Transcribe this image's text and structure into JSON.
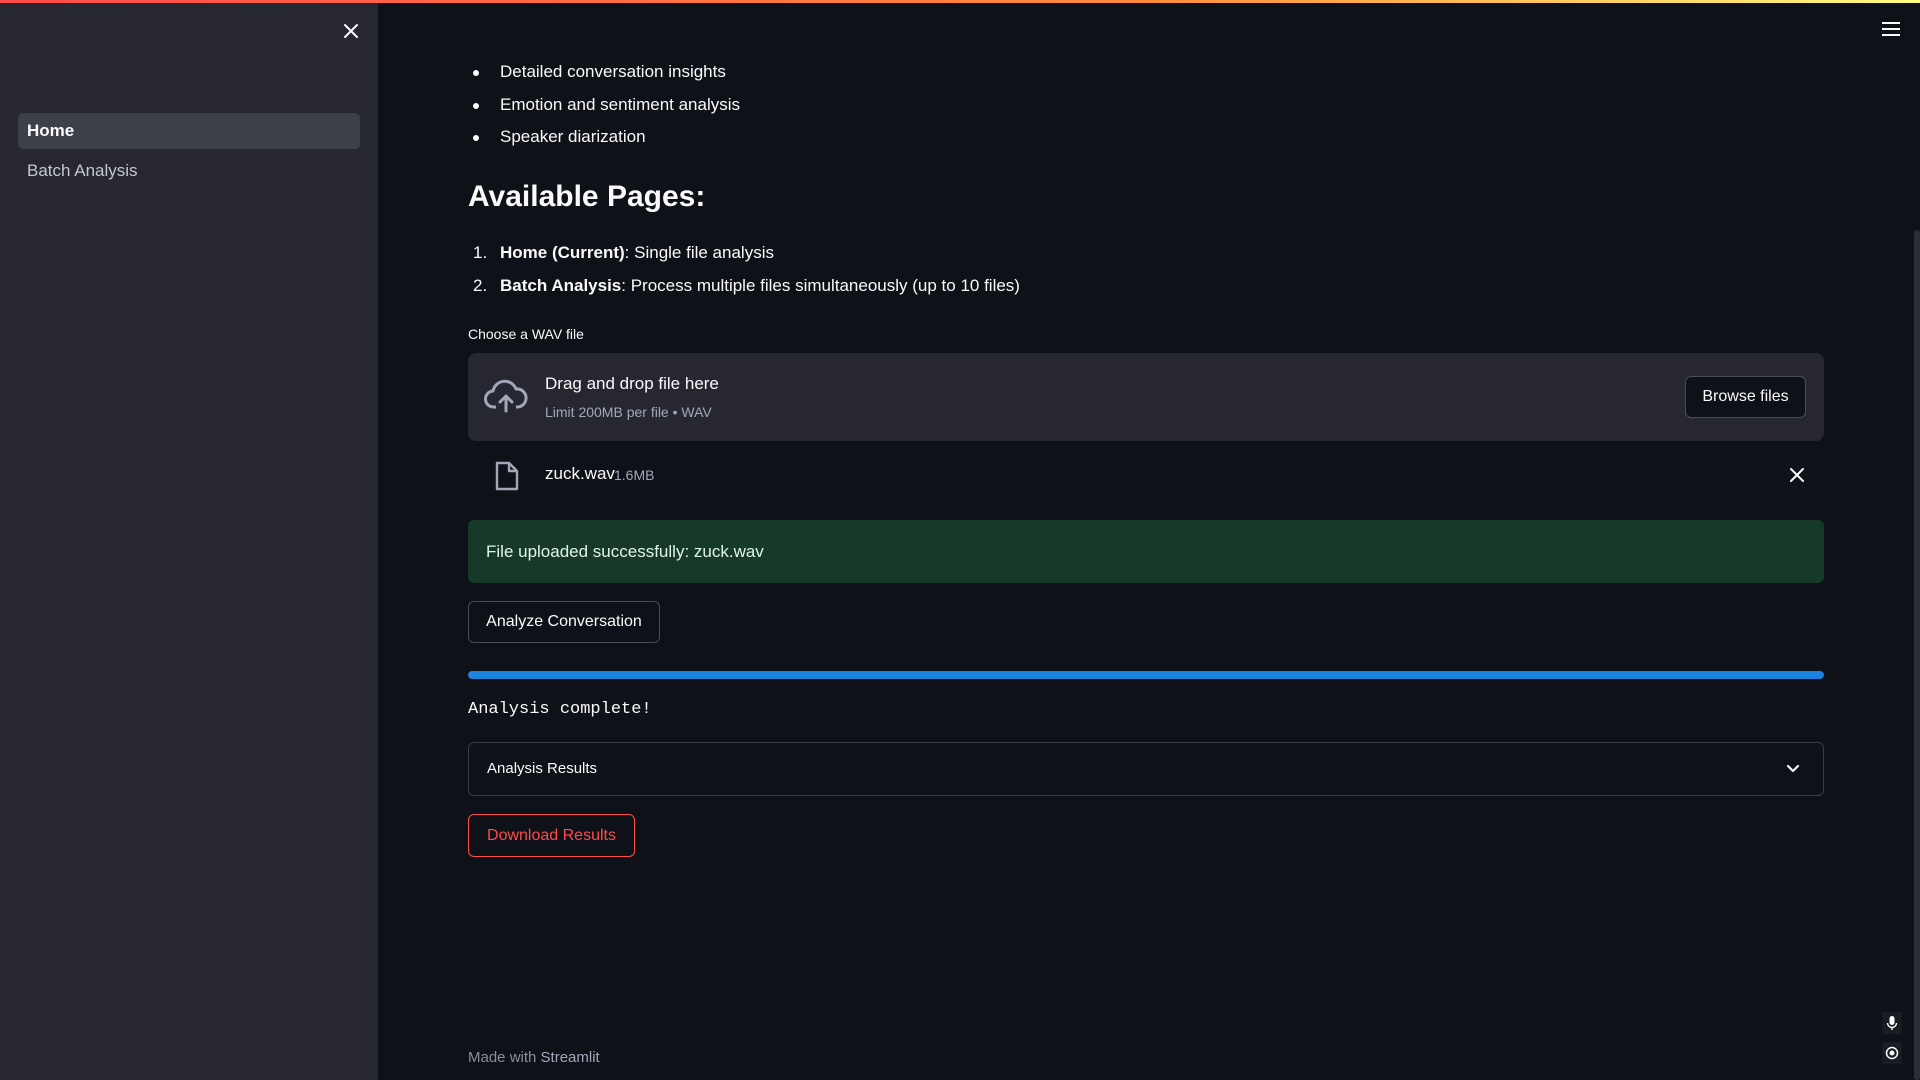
{
  "sidebar": {
    "items": [
      {
        "label": "Home",
        "active": true
      },
      {
        "label": "Batch Analysis",
        "active": false
      }
    ]
  },
  "main": {
    "features": [
      "Detailed conversation insights",
      "Emotion and sentiment analysis",
      "Speaker diarization"
    ],
    "pages_heading": "Available Pages:",
    "pages": [
      {
        "num": "1.",
        "name": "Home (Current)",
        "desc": ": Single file analysis"
      },
      {
        "num": "2.",
        "name": "Batch Analysis",
        "desc": ": Process multiple files simultaneously (up to 10 files)"
      }
    ],
    "uploader": {
      "label": "Choose a WAV file",
      "drop_title": "Drag and drop file here",
      "drop_limit": "Limit 200MB per file • WAV",
      "browse_label": "Browse files"
    },
    "file": {
      "name": "zuck.wav",
      "size": "1.6MB"
    },
    "success_message": "File uploaded successfully: zuck.wav",
    "analyze_label": "Analyze Conversation",
    "progress_percent": 100,
    "status_text": "Analysis complete!",
    "expander_label": "Analysis Results",
    "download_label": "Download Results",
    "footer_prefix": "Made with ",
    "footer_brand": "Streamlit"
  },
  "colors": {
    "background": "#0e1117",
    "sidebar": "#262730",
    "accent": "#ff4b4b",
    "progress": "#1c83e1",
    "success_bg": "#173928"
  }
}
